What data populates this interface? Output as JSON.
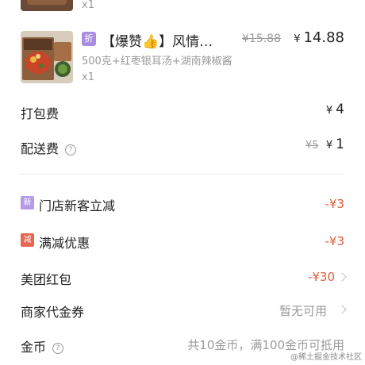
{
  "items": [
    {
      "quantity": "x1"
    },
    {
      "discount_tag": "折",
      "name": "【爆赞👍】风情…",
      "spec": "500克+红枣银耳汤+湖南辣椒酱",
      "original_price": "¥15.88",
      "price": "14.88",
      "quantity": "x1"
    }
  ],
  "fees": {
    "packing_label": "打包费",
    "packing_value": "4",
    "delivery_label": "配送费",
    "delivery_original": "¥5",
    "delivery_value": "1",
    "currency": "¥",
    "help_icon_glyph": "?"
  },
  "promotions": {
    "new_customer": {
      "badge": "新",
      "label": "门店新客立减",
      "amount": "-¥3"
    },
    "full_reduction": {
      "badge": "减",
      "label": "满减优惠",
      "amount": "-¥3"
    },
    "meituan_redpacket": {
      "label": "美团红包",
      "amount": "-¥30"
    },
    "merchant_voucher": {
      "label": "商家代金券",
      "status": "暂无可用"
    },
    "coins": {
      "label": "金币",
      "note": "共10金币，满100金币可抵用"
    }
  },
  "watermark": "@稀土掘金技术社区",
  "colors": {
    "discount_red": "#e35d3c",
    "tag_purple": "#a88de0",
    "badge_red": "#e8674f"
  }
}
